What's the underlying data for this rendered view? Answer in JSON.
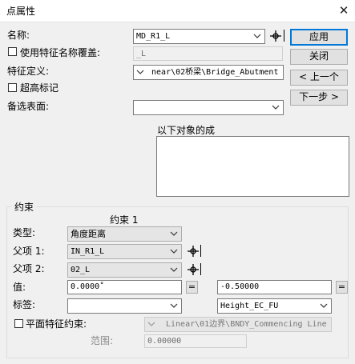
{
  "window": {
    "title": "点属性",
    "close_glyph": "✕"
  },
  "name": {
    "label": "名称:",
    "value": "MD_R1_L"
  },
  "use_feature_name": {
    "label": "使用特征名称覆盖:",
    "value": "_L",
    "checked": false
  },
  "feature_def": {
    "label": "特征定义:",
    "value": "near\\02桥梁\\Bridge_Abutment"
  },
  "super_elevation": {
    "label": "超高标记",
    "checked": false
  },
  "alt_surface": {
    "label": "备选表面:",
    "value": ""
  },
  "objects_list": {
    "label": "以下对象的成"
  },
  "buttons": {
    "apply": "应用",
    "close": "关闭",
    "prev": "< 上一个",
    "next": "下一步 >"
  },
  "constraints": {
    "group_label": "约束",
    "header": "约束 1",
    "type": {
      "label": "类型:",
      "value": "角度距离"
    },
    "parent1": {
      "label": "父项 1:",
      "value": "IN_R1_L"
    },
    "parent2": {
      "label": "父项 2:",
      "value": "02_L"
    },
    "value": {
      "label": "值:",
      "value1": "0.0000˚",
      "value2": "-0.50000",
      "eq_label": "="
    },
    "tag": {
      "label": "标签:",
      "value1": "",
      "value2": "Height_EC_FU"
    },
    "planar": {
      "label": "平面特征约束:",
      "checked": false,
      "value": "Linear\\01边界\\BNDY_Commencing Line"
    },
    "range": {
      "label": "范围:",
      "value": "0.00000"
    }
  },
  "icons": {
    "pick": "crosshair-pick-icon",
    "dropdown": "chevron-down-icon",
    "close": "close-icon"
  }
}
